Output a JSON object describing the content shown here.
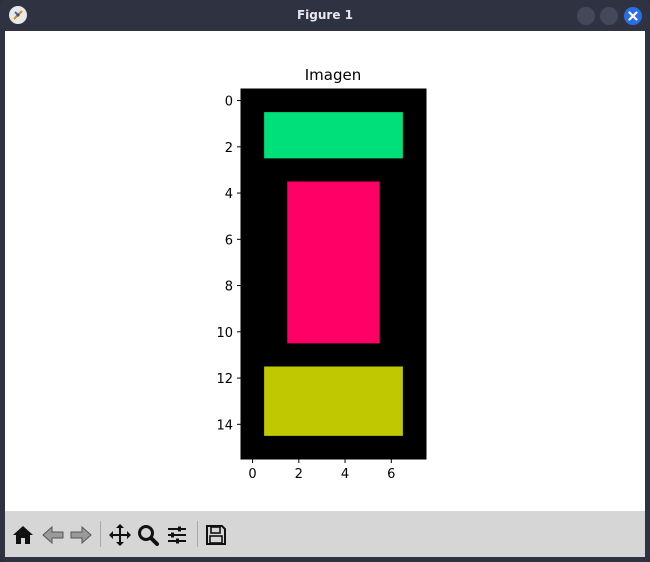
{
  "window": {
    "title": "Figure 1",
    "app_icon": "matplotlib-icon",
    "controls": [
      "minimize-icon",
      "maximize-icon",
      "close-icon"
    ]
  },
  "toolbar": {
    "buttons": [
      {
        "name": "home-button",
        "icon": "home-icon"
      },
      {
        "name": "back-button",
        "icon": "back-arrow-icon"
      },
      {
        "name": "forward-button",
        "icon": "forward-arrow-icon"
      },
      {
        "name": "pan-button",
        "icon": "move-icon"
      },
      {
        "name": "zoom-button",
        "icon": "magnifier-icon"
      },
      {
        "name": "configure-subplots-button",
        "icon": "sliders-icon"
      },
      {
        "name": "save-button",
        "icon": "floppy-disk-icon"
      }
    ]
  },
  "chart_data": {
    "type": "heatmap",
    "title": "Imagen",
    "xlabel": "",
    "ylabel": "",
    "xlim": [
      -0.5,
      7.5
    ],
    "ylim": [
      15.5,
      -0.5
    ],
    "x_ticks": [
      0,
      2,
      4,
      6
    ],
    "y_ticks": [
      0,
      2,
      4,
      6,
      8,
      10,
      12,
      14
    ],
    "x_tick_labels": [
      "0",
      "2",
      "4",
      "6"
    ],
    "y_tick_labels": [
      "0",
      "2",
      "4",
      "6",
      "8",
      "10",
      "12",
      "14"
    ],
    "grid": false,
    "background_color": "#000000",
    "rectangles": [
      {
        "label": "green block",
        "col_start": 1,
        "col_end": 6,
        "row_start": 1,
        "row_end": 2,
        "color": "#00e07a"
      },
      {
        "label": "pink block",
        "col_start": 2,
        "col_end": 5,
        "row_start": 4,
        "row_end": 10,
        "color": "#ff0066"
      },
      {
        "label": "yellow block",
        "col_start": 1,
        "col_end": 6,
        "row_start": 12,
        "row_end": 14,
        "color": "#bfc800"
      }
    ]
  }
}
